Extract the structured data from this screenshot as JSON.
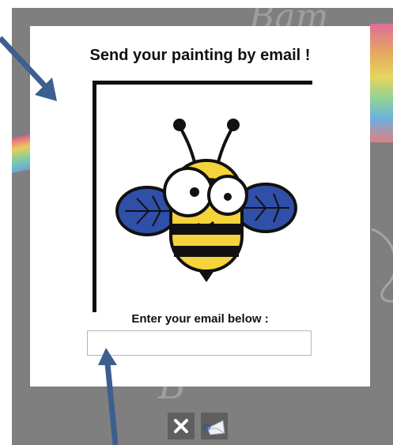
{
  "dialog": {
    "title": "Send your painting by email !",
    "email_label": "Enter your email below :",
    "email_value": "",
    "email_placeholder": ""
  },
  "background": {
    "deco_letters_top": "Bam",
    "deco_letter_bottom": "B"
  },
  "toolbar": {
    "close_icon": "close-icon",
    "send_icon": "send-email-icon",
    "send_symbol": "@"
  },
  "colors": {
    "backdrop": "#7f7f7f",
    "dialog": "#ffffff",
    "arrow": "#3d5f8f",
    "button_bg": "#5f5f5f"
  }
}
